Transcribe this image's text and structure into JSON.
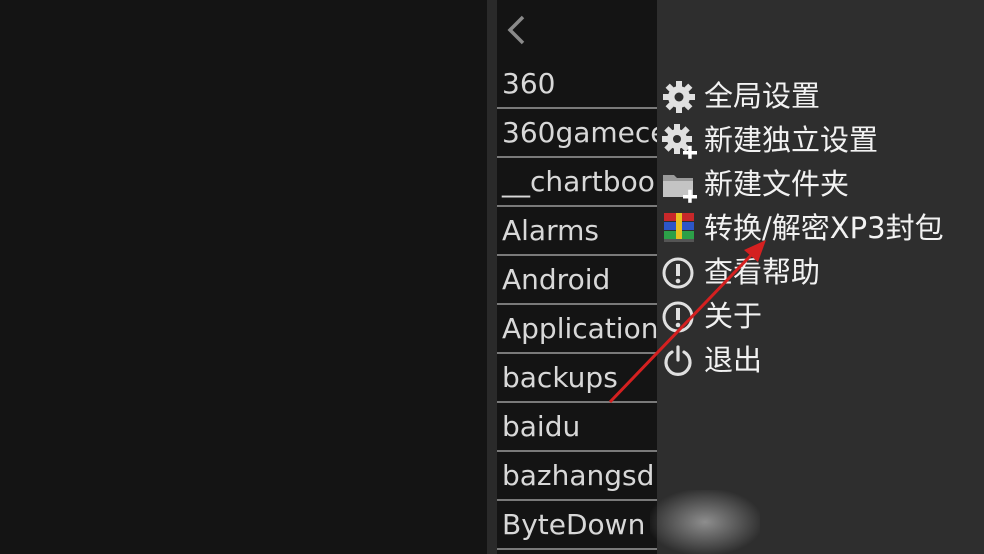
{
  "file_list": {
    "items": [
      "360",
      "360gamece",
      "__chartboo",
      "Alarms",
      "Android",
      "Application",
      "backups",
      "baidu",
      "bazhangsd",
      "ByteDown"
    ]
  },
  "menu": {
    "items": [
      {
        "label": "全局设置",
        "icon": "gear-icon"
      },
      {
        "label": "新建独立设置",
        "icon": "gear-plus-icon"
      },
      {
        "label": "新建文件夹",
        "icon": "folder-plus-icon"
      },
      {
        "label": "转换/解密XP3封包",
        "icon": "archive-icon"
      },
      {
        "label": "查看帮助",
        "icon": "info-circle-icon"
      },
      {
        "label": "关于",
        "icon": "info-circle-icon"
      },
      {
        "label": "退出",
        "icon": "power-icon"
      }
    ]
  },
  "colors": {
    "background": "#141414",
    "menu_background": "#2e2e2e",
    "annotation_arrow": "#d42020"
  }
}
